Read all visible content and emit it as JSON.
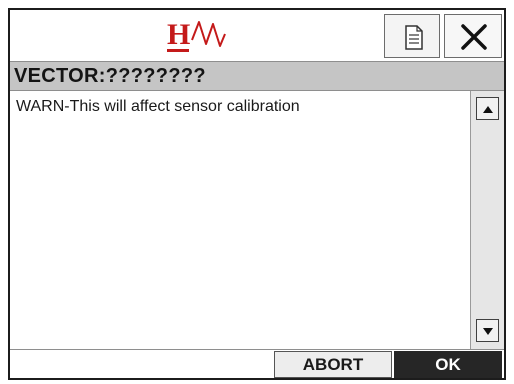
{
  "header": {
    "logo_icon": "hw-waveform-logo",
    "logo_letter": "H",
    "colors": {
      "logo_red": "#c41a1a"
    },
    "document_button_icon": "document-icon",
    "close_button_icon": "close-icon"
  },
  "title_bar": {
    "title": "VECTOR:????????"
  },
  "content": {
    "message": "WARN-This will affect sensor calibration"
  },
  "scrollbar": {
    "up_icon": "arrow-up-icon",
    "down_icon": "arrow-down-icon"
  },
  "footer": {
    "abort_label": "ABORT",
    "ok_label": "OK"
  }
}
